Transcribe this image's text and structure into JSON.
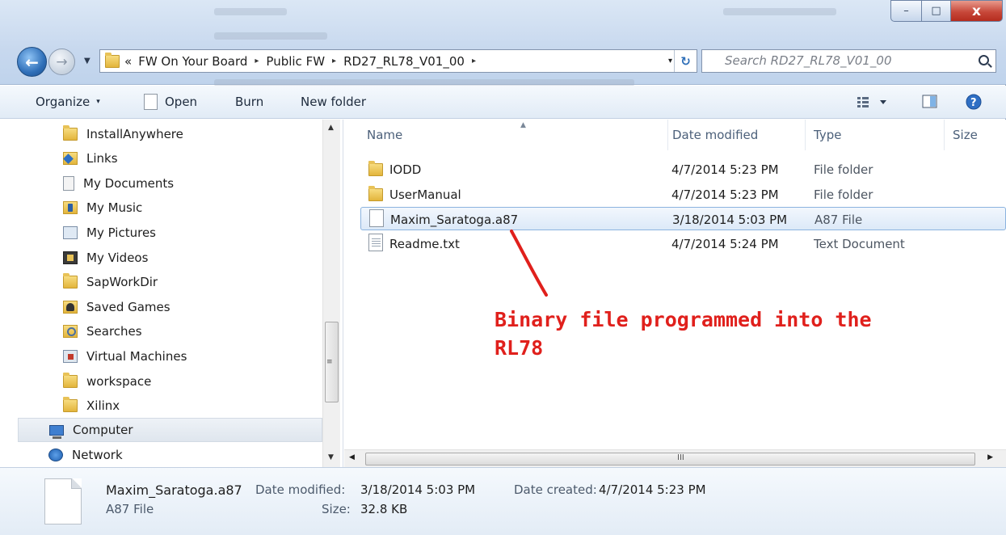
{
  "window": {
    "controls": {
      "minimize": "–",
      "maximize": "□",
      "close": "x"
    }
  },
  "address_bar": {
    "overflow": "«",
    "breadcrumbs": [
      "FW On Your Board",
      "Public FW",
      "RD27_RL78_V01_00"
    ],
    "separator": "▸",
    "dropdown": "▾",
    "refresh": "↻"
  },
  "search": {
    "placeholder": "Search RD27_RL78_V01_00"
  },
  "toolbar": {
    "organize": "Organize",
    "open": "Open",
    "burn": "Burn",
    "new_folder": "New folder",
    "dropdown": "▾"
  },
  "navigation": {
    "items": [
      {
        "label": "InstallAnywhere",
        "icon": "folder-icon"
      },
      {
        "label": "Links",
        "icon": "links-icon"
      },
      {
        "label": "My Documents",
        "icon": "documents-icon"
      },
      {
        "label": "My Music",
        "icon": "music-icon"
      },
      {
        "label": "My Pictures",
        "icon": "pictures-icon"
      },
      {
        "label": "My Videos",
        "icon": "videos-icon"
      },
      {
        "label": "SapWorkDir",
        "icon": "folder-icon"
      },
      {
        "label": "Saved Games",
        "icon": "saved-games-icon"
      },
      {
        "label": "Searches",
        "icon": "searches-icon"
      },
      {
        "label": "Virtual Machines",
        "icon": "virtual-machines-icon"
      },
      {
        "label": "workspace",
        "icon": "folder-icon"
      },
      {
        "label": "Xilinx",
        "icon": "folder-icon"
      },
      {
        "label": "Computer",
        "icon": "computer-icon"
      },
      {
        "label": "Network",
        "icon": "network-icon"
      }
    ]
  },
  "file_list": {
    "columns": [
      "Name",
      "Date modified",
      "Type",
      "Size"
    ],
    "rows": [
      {
        "name": "IODD",
        "date": "4/7/2014 5:23 PM",
        "type": "File folder",
        "icon": "folder-icon"
      },
      {
        "name": "UserManual",
        "date": "4/7/2014 5:23 PM",
        "type": "File folder",
        "icon": "folder-icon"
      },
      {
        "name": "Maxim_Saratoga.a87",
        "date": "3/18/2014 5:03 PM",
        "type": "A87 File",
        "icon": "file-icon",
        "selected": true
      },
      {
        "name": "Readme.txt",
        "date": "4/7/2014 5:24 PM",
        "type": "Text Document",
        "icon": "text-file-icon"
      }
    ]
  },
  "annotation": {
    "text_line1": "Binary file programmed into the",
    "text_line2": "RL78",
    "color": "#e0201c"
  },
  "details_pane": {
    "file_name": "Maxim_Saratoga.a87",
    "file_type": "A87 File",
    "date_modified_label": "Date modified:",
    "date_modified": "3/18/2014 5:03 PM",
    "size_label": "Size:",
    "size": "32.8 KB",
    "date_created_label": "Date created:",
    "date_created": "4/7/2014 5:23 PM"
  },
  "scrollbars": {
    "grip": "III"
  }
}
